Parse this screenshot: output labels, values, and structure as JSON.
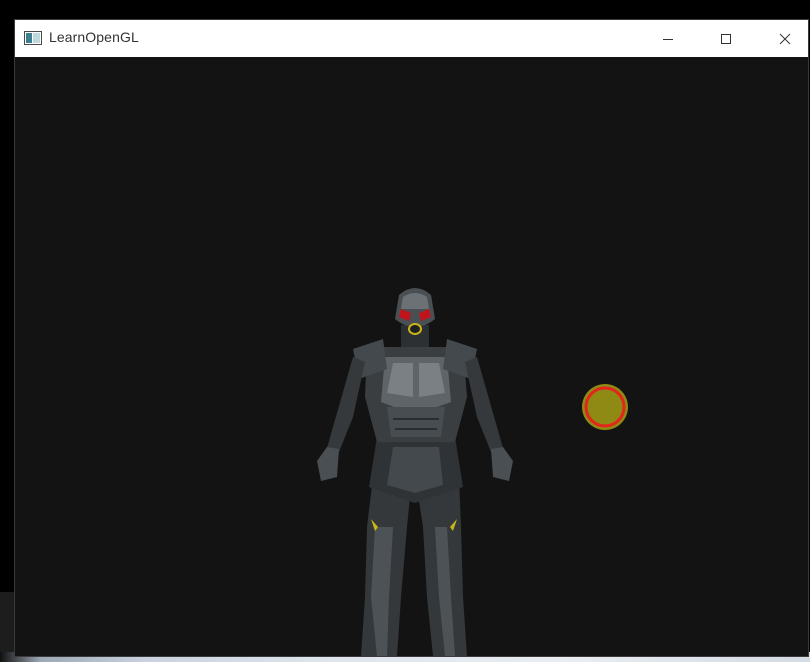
{
  "window": {
    "title": "LearnOpenGL",
    "controls": {
      "minimize": "minimize-icon",
      "maximize": "maximize-icon",
      "close": "close-icon"
    }
  },
  "scene": {
    "background_color": "#131313",
    "model_colors": {
      "armor": "#3c4043",
      "armor_highlight": "#6a6f73",
      "visor": "#c0141c",
      "accent": "#c9b51a"
    },
    "light_marker": {
      "fill_color": "#8f8a14",
      "ring_color": "#e2261c"
    }
  }
}
